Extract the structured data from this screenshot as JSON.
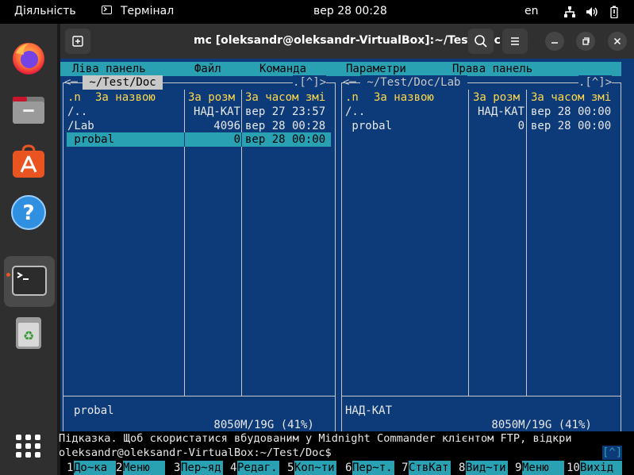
{
  "topbar": {
    "activities": "Діяльність",
    "app_name": "Термінал",
    "clock": "вер 28  00:28",
    "lang": "en"
  },
  "window": {
    "title": "mc [oleksandr@oleksandr-VirtualBox]:~/Test/Doc"
  },
  "mc": {
    "menu": [
      "Ліва панель",
      "Файл",
      "Команда",
      "Параметри",
      "Права панель"
    ],
    "left": {
      "path": " ~/Test/Doc ",
      "hist": ".[^]>",
      "col_n": ".n",
      "col_name": "За назвою",
      "col_size": "За розм",
      "col_time": "За часом змі",
      "rows": [
        {
          "name": "/..",
          "size": "НАД-КАТ",
          "time": "вер 27 23:57"
        },
        {
          "name": "/Lab",
          "size": "4096",
          "time": "вер 28 00:28"
        },
        {
          "name": " probal",
          "size": "0",
          "time": "вер 28 00:00"
        }
      ],
      "mini": "probal",
      "free": " 8050M/19G (41%) "
    },
    "right": {
      "path": " ~/Test/Doc/Lab ",
      "hist": ".[^]>",
      "col_n": ".n",
      "col_name": "За назвою",
      "col_size": "За розм",
      "col_time": "За часом змі",
      "rows": [
        {
          "name": "/..",
          "size": "НАД-КАТ",
          "time": "вер 28 00:00"
        },
        {
          "name": " probal",
          "size": "0",
          "time": "вер 28 00:00"
        }
      ],
      "mini": "НАД-КАТ",
      "free": " 8050M/19G (41%) "
    },
    "hint": "Підказка. Щоб скористатися вбудованим у Midnight Commander клієнтом FTP, відкри",
    "prompt": "oleksandr@oleksandr-VirtualBox:~/Test/Doc$",
    "prompt_hist": "[^]",
    "fkeys": [
      {
        "n": "1",
        "label": "До~ка"
      },
      {
        "n": "2",
        "label": "Меню"
      },
      {
        "n": "3",
        "label": "Пер~яд"
      },
      {
        "n": "4",
        "label": "Редаг."
      },
      {
        "n": "5",
        "label": "Коп~ти"
      },
      {
        "n": "6",
        "label": "Пер~т."
      },
      {
        "n": "7",
        "label": "СтвКат"
      },
      {
        "n": "8",
        "label": "Вид~ти"
      },
      {
        "n": "9",
        "label": "Меню"
      },
      {
        "n": "10",
        "label": "Вихід"
      }
    ]
  },
  "colors": {
    "mc_background": "#0d3a78",
    "mc_cyan": "#2aa1b3",
    "mc_yellow": "#ffd94a",
    "dock": "#2f2f2f",
    "titlebar": "#303030",
    "ubuntu_orange": "#e95420"
  },
  "icons": {
    "dock": [
      "firefox-icon",
      "files-icon",
      "app-center-icon",
      "help-icon",
      "terminal-icon",
      "trash-icon",
      "show-apps-icon"
    ],
    "topbar": [
      "terminal-app-icon",
      "network-icon",
      "volume-icon",
      "battery-icon"
    ],
    "window": [
      "new-tab-icon",
      "search-icon",
      "hamburger-menu-icon",
      "minimize-icon",
      "maximize-icon",
      "close-icon"
    ]
  }
}
